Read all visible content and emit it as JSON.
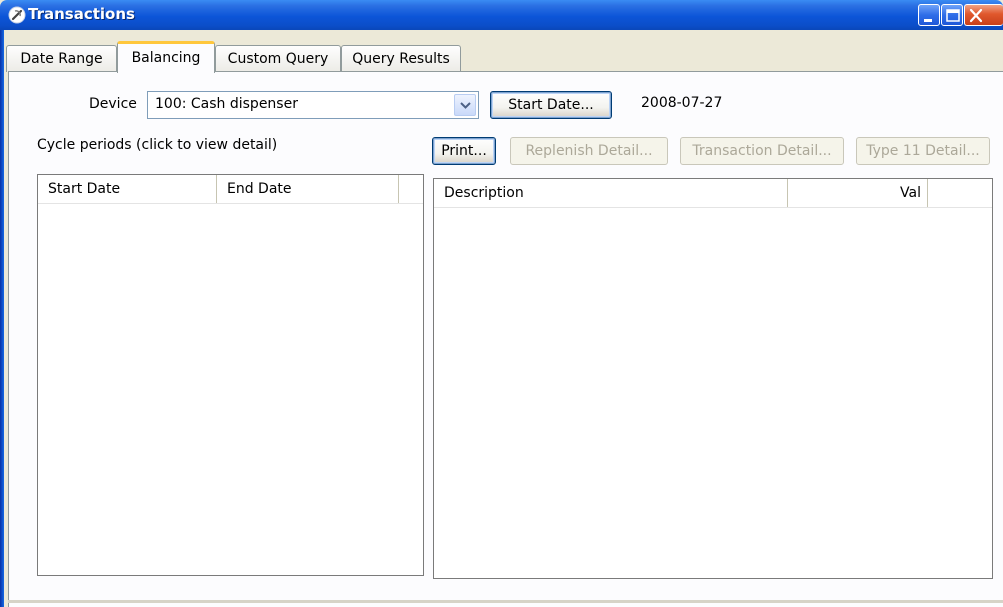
{
  "window": {
    "title": "Transactions"
  },
  "tabs": [
    {
      "label": "Date Range",
      "active": false
    },
    {
      "label": "Balancing",
      "active": true
    },
    {
      "label": "Custom Query",
      "active": false
    },
    {
      "label": "Query Results",
      "active": false
    }
  ],
  "device": {
    "label": "Device",
    "selected": "100: Cash dispenser"
  },
  "start_date": {
    "button_label": "Start Date...",
    "value": "2008-07-27"
  },
  "cycle_periods": {
    "caption": "Cycle periods (click to view detail)",
    "columns": [
      "Start Date",
      "End Date"
    ],
    "rows": []
  },
  "actions": {
    "print": "Print...",
    "replenish_detail": "Replenish Detail...",
    "transaction_detail": "Transaction Detail...",
    "type11_detail": "Type 11 Detail..."
  },
  "detail_table": {
    "columns": [
      "Description",
      "Val"
    ],
    "rows": []
  },
  "colors": {
    "titlebar": "#0c55d8",
    "active_tab_accent": "#ffc73c",
    "panel_bg": "#fcfcfe"
  }
}
